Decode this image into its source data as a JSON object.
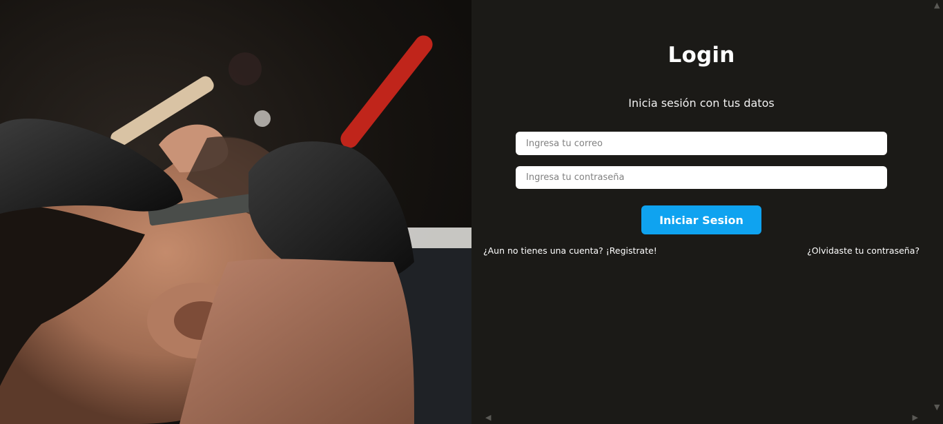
{
  "hero_image": {
    "subject": "barber-shaving-client-image",
    "colors": {
      "glove": "#151515",
      "razor_handle": "#c0251b",
      "skin": "#b07a5e"
    }
  },
  "login": {
    "title": "Login",
    "subtitle": "Inicia sesión con tus datos",
    "email_placeholder": "Ingresa tu correo",
    "password_placeholder": "Ingresa tu contraseña",
    "submit_label": "Iniciar Sesion",
    "register_link": "¿Aun no tienes una cuenta? ¡Registrate!",
    "forgot_link": "¿Olvidaste tu contraseña?"
  },
  "colors": {
    "background": "#1b1a17",
    "accent": "#0fa3f0",
    "text": "#ffffff"
  },
  "scrollbars": {
    "up_icon": "chevron-up-icon",
    "down_icon": "chevron-down-icon",
    "left_icon": "chevron-left-icon",
    "right_icon": "chevron-right-icon"
  }
}
